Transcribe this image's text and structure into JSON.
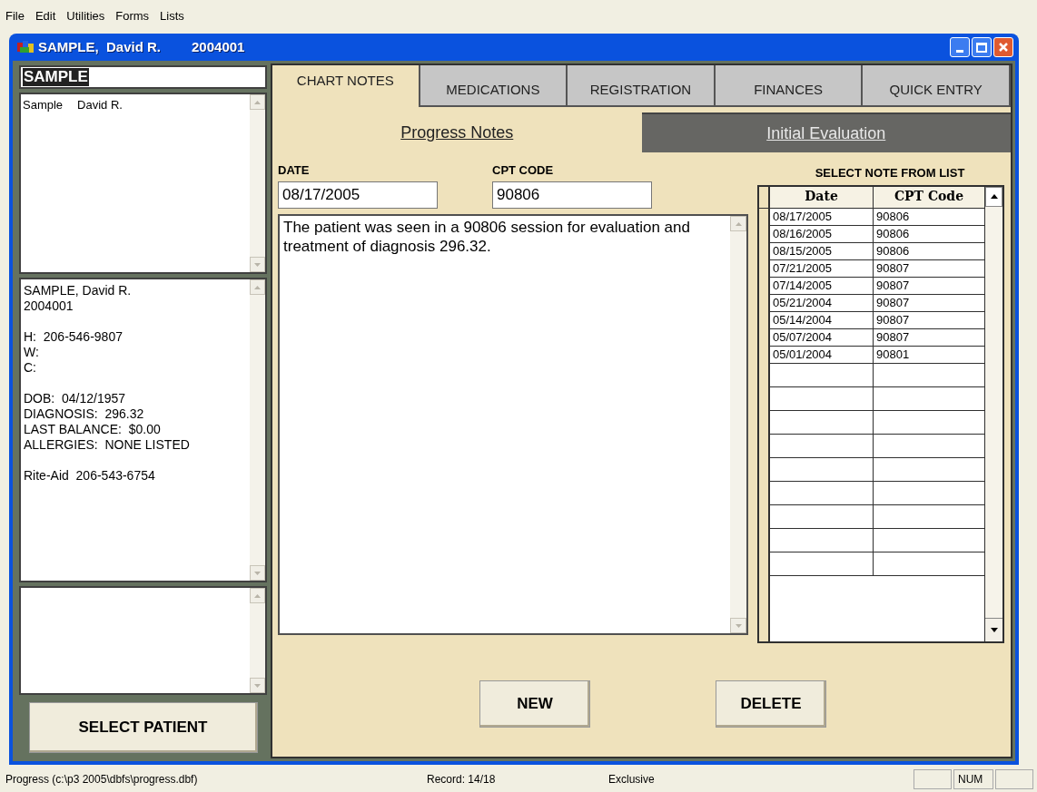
{
  "menu": [
    "File",
    "Edit",
    "Utilities",
    "Forms",
    "Lists"
  ],
  "window": {
    "title": [
      "SAMPLE,  David R.",
      "2004001"
    ]
  },
  "search": {
    "value": "SAMPLE"
  },
  "patients": [
    {
      "last": "Sample",
      "first": "David R."
    }
  ],
  "info": [
    [
      "SAMPLE, David R.",
      "2004001"
    ],
    [
      "H:  206-546-9807",
      "W:",
      "C:"
    ],
    [
      "DOB:  04/12/1957",
      "DIAGNOSIS:  296.32",
      "LAST BALANCE:  $0.00",
      "ALLERGIES:  NONE LISTED"
    ],
    [
      "Rite-Aid  206-543-6754"
    ]
  ],
  "select_button": "SELECT PATIENT",
  "tabs": [
    {
      "label": "CHART NOTES",
      "selected": true
    },
    {
      "label": "MEDICATIONS",
      "selected": false
    },
    {
      "label": "REGISTRATION",
      "selected": false
    },
    {
      "label": "FINANCES",
      "selected": false
    },
    {
      "label": "QUICK ENTRY",
      "selected": false
    }
  ],
  "subtabs": [
    {
      "label": "Progress Notes",
      "selected": true
    },
    {
      "label": "Initial Evaluation",
      "selected": false
    }
  ],
  "date": {
    "label": "DATE",
    "value": "08/17/2005"
  },
  "cpt": {
    "label": "CPT CODE",
    "value": "90806"
  },
  "note": "The patient was seen in a 90806 session for evaluation and treatment of diagnosis 296.32.",
  "grid": {
    "title": "SELECT NOTE FROM LIST",
    "columns": [
      "Date",
      "CPT Code"
    ],
    "rows": [
      [
        "08/17/2005",
        "90806"
      ],
      [
        "08/16/2005",
        "90806"
      ],
      [
        "08/15/2005",
        "90806"
      ],
      [
        "07/21/2005",
        "90807"
      ],
      [
        "07/14/2005",
        "90807"
      ],
      [
        "05/21/2004",
        "90807"
      ],
      [
        "05/14/2004",
        "90807"
      ],
      [
        "05/07/2004",
        "90807"
      ],
      [
        "05/01/2004",
        "90801"
      ]
    ]
  },
  "buttons": [
    "NEW",
    "DELETE"
  ],
  "status_bar": {
    "file": "Progress (c:\\p3 2005\\dbfs\\progress.dbf)",
    "record": "Record: 14/18",
    "mode": "Exclusive",
    "num": "NUM"
  }
}
